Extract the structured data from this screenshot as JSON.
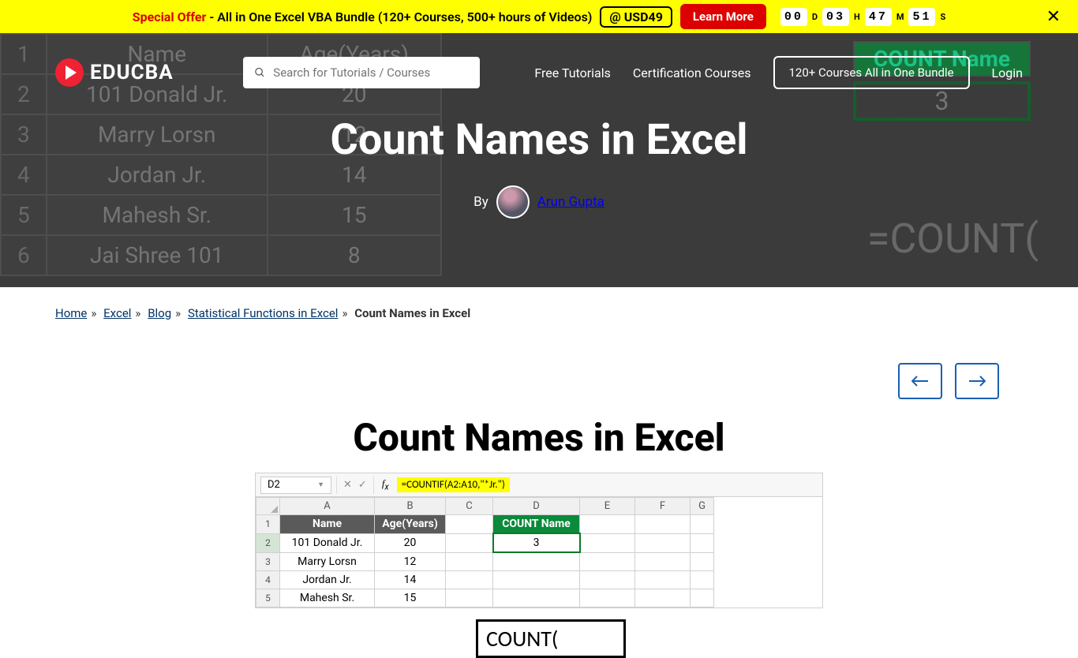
{
  "promo": {
    "special": "Special Offer",
    "text": " - All in One Excel VBA Bundle (120+ Courses, 500+ hours of Videos)",
    "price": "@ USD49",
    "learn_more": "Learn More",
    "countdown": {
      "d": "00",
      "h": "03",
      "m": "47",
      "s": "51"
    },
    "labels": {
      "d": "D",
      "h": "H",
      "m": "M",
      "s": "S"
    }
  },
  "nav": {
    "brand": "EDUCBA",
    "search_placeholder": "Search for Tutorials / Courses",
    "free_tutorials": "Free Tutorials",
    "cert_courses": "Certification Courses",
    "bundle": "120+ Courses All in One Bundle",
    "login": "Login"
  },
  "hero": {
    "title": "Count Names in Excel",
    "by": "By",
    "author": "Arun Gupta",
    "bg_rows": [
      {
        "n": "1",
        "name": "Name",
        "age": "Age(Years)"
      },
      {
        "n": "2",
        "name": "101 Donald Jr.",
        "age": "20"
      },
      {
        "n": "3",
        "name": "Marry Lorsn",
        "age": "12"
      },
      {
        "n": "4",
        "name": "Jordan Jr.",
        "age": "14"
      },
      {
        "n": "5",
        "name": "Mahesh Sr.",
        "age": "15"
      },
      {
        "n": "6",
        "name": "Jai Shree 101",
        "age": "8"
      }
    ],
    "bg_count_label": "COUNT Name",
    "bg_count_val": "3",
    "bg_formula": "=COUNT("
  },
  "breadcrumb": {
    "home": "Home",
    "excel": "Excel",
    "blog": "Blog",
    "stats": "Statistical Functions in Excel",
    "current": "Count Names in Excel"
  },
  "article": {
    "title": "Count Names in Excel",
    "excel": {
      "namebox": "D2",
      "formula": "=COUNTIF(A2:A10,\"*Jr.\")",
      "cols": [
        "A",
        "B",
        "C",
        "D",
        "E",
        "F",
        "G"
      ],
      "header_row": {
        "name": "Name",
        "age": "Age(Years)",
        "count": "COUNT Name"
      },
      "count_result": "3",
      "rows": [
        {
          "n": "2",
          "name": "101 Donald Jr.",
          "age": "20"
        },
        {
          "n": "3",
          "name": "Marry Lorsn",
          "age": "12"
        },
        {
          "n": "4",
          "name": "Jordan Jr.",
          "age": "14"
        },
        {
          "n": "5",
          "name": "Mahesh Sr.",
          "age": "15"
        }
      ],
      "callout": "COUNT("
    }
  }
}
